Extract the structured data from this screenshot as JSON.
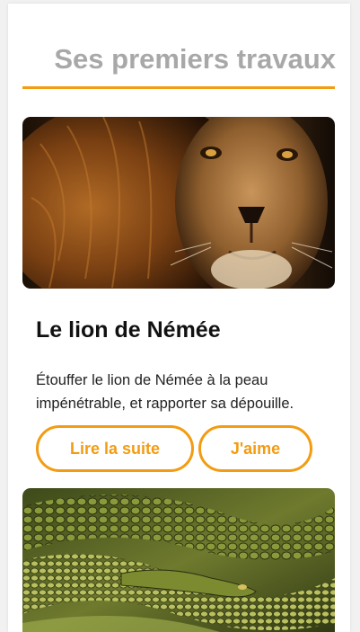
{
  "section": {
    "title": "Ses premiers travaux",
    "accent_color": "#f39c12"
  },
  "cards": [
    {
      "image_icon": "lion-photo",
      "title": "Le lion de Némée",
      "text": "Étouffer le lion de Némée à la peau impénétrable, et rapporter sa dépouille.",
      "read_more_label": "Lire la suite",
      "like_label": "J'aime"
    },
    {
      "image_icon": "snake-photo"
    }
  ]
}
